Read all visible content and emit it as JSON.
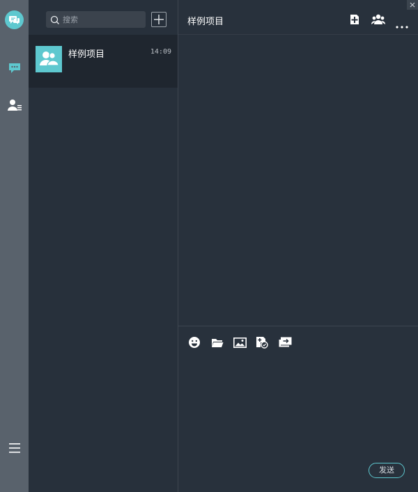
{
  "search": {
    "placeholder": "搜索"
  },
  "conversations": [
    {
      "name": "样例项目",
      "time": "14:09",
      "avatar_icon": "group-icon"
    }
  ],
  "chat": {
    "title": "样例项目",
    "send_label": "发送"
  },
  "colors": {
    "accent": "#5ec8cf",
    "rail": "#59626c",
    "list_bg": "#27303b",
    "selected_row": "#1f262f",
    "chat_bg": "#28313c"
  },
  "icons": {
    "rail": [
      "app-logo-icon",
      "chat-icon",
      "contacts-icon",
      "menu-icon"
    ],
    "header": [
      "add-file-icon",
      "group-members-icon",
      "more-icon"
    ],
    "toolbar": [
      "emoji-icon",
      "folder-icon",
      "image-icon",
      "screenshot-icon",
      "screen-share-icon"
    ]
  }
}
